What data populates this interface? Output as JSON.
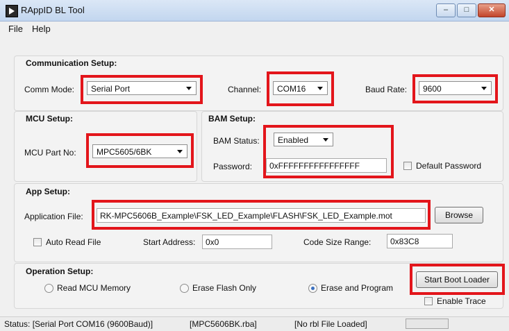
{
  "window": {
    "title": "RAppID BL Tool"
  },
  "menu": {
    "items": [
      "File",
      "Help"
    ]
  },
  "comm_setup": {
    "title": "Communication Setup:",
    "comm_mode_label": "Comm Mode:",
    "comm_mode_value": "Serial Port",
    "channel_label": "Channel:",
    "channel_value": "COM16",
    "baud_label": "Baud Rate:",
    "baud_value": "9600"
  },
  "mcu_setup": {
    "title": "MCU Setup:",
    "part_label": "MCU Part No:",
    "part_value": "MPC5605/6BK"
  },
  "bam_setup": {
    "title": "BAM Setup:",
    "status_label": "BAM Status:",
    "status_value": "Enabled",
    "password_label": "Password:",
    "password_value": "0xFFFFFFFFFFFFFFFF",
    "default_password_label": "Default Password"
  },
  "app_setup": {
    "title": "App Setup:",
    "app_file_label": "Application File:",
    "app_file_value": "RK-MPC5606B_Example\\FSK_LED_Example\\FLASH\\FSK_LED_Example.mot",
    "browse_label": "Browse",
    "auto_read_label": "Auto Read File",
    "start_address_label": "Start Address:",
    "start_address_value": "0x0",
    "code_size_label": "Code Size Range:",
    "code_size_value": "0x83C8"
  },
  "operation_setup": {
    "title": "Operation Setup:",
    "options": [
      "Read MCU Memory",
      "Erase Flash Only",
      "Erase and Program"
    ],
    "selected": "Erase and Program",
    "start_button_label": "Start Boot Loader",
    "enable_trace_label": "Enable Trace"
  },
  "status_bar": {
    "status": "Status: [Serial Port COM16 (9600Baud)]",
    "file": "[MPC5606BK.rba]",
    "rbl": "[No rbl File Loaded]"
  },
  "colors": {
    "highlight": "#e3151b",
    "radio_selected": "#3a6fbf"
  }
}
